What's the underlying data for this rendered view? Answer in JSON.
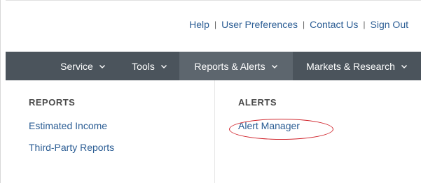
{
  "utility_nav": {
    "links": [
      "Help",
      "User Preferences",
      "Contact Us",
      "Sign Out"
    ],
    "separator": "|"
  },
  "main_nav": {
    "items": [
      {
        "label": "Service",
        "icon": "chevron-down-icon"
      },
      {
        "label": "Tools",
        "icon": "chevron-down-icon"
      },
      {
        "label": "Reports & Alerts",
        "icon": "chevron-down-icon",
        "active": true
      },
      {
        "label": "Markets & Research",
        "icon": "chevron-down-icon"
      }
    ]
  },
  "dropdown": {
    "reports": {
      "heading": "REPORTS",
      "links": [
        "Estimated Income",
        "Third-Party Reports"
      ]
    },
    "alerts": {
      "heading": "ALERTS",
      "links": [
        "Alert Manager"
      ]
    }
  },
  "colors": {
    "nav_background": "#4b545c",
    "nav_active_background": "#5d666e",
    "link": "#2b5d94",
    "highlight_oval": "#d0232b"
  }
}
